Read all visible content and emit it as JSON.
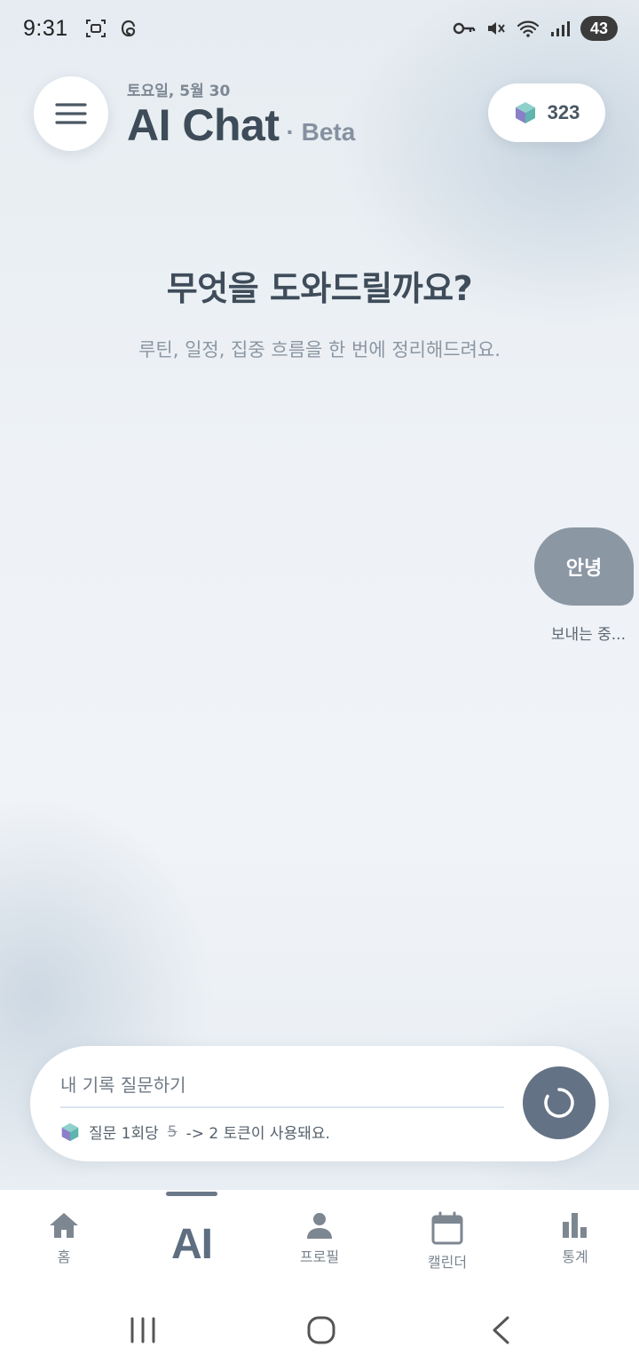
{
  "status_bar": {
    "time": "9:31",
    "battery": "43",
    "icons_left": [
      "screenshot-icon",
      "threads-icon"
    ],
    "icons_right": [
      "vpn-key-icon",
      "mute-icon",
      "wifi-icon",
      "signal-icon"
    ]
  },
  "header": {
    "date": "토요일, 5월 30",
    "title": "AI Chat",
    "badge": "· Beta",
    "token_count": "323"
  },
  "hero": {
    "title": "무엇을 도와드릴까요?",
    "subtitle": "루틴, 일정, 집중 흐름을 한 번에 정리해드려요."
  },
  "messages": [
    {
      "role": "user",
      "text": "안녕",
      "status": "보내는 중..."
    }
  ],
  "composer": {
    "placeholder": "내 기록 질문하기",
    "hint_prefix": "질문 1회당",
    "hint_old_cost": "5",
    "hint_suffix": "-> 2 토큰이 사용돼요."
  },
  "bottom_nav": {
    "active": "AI",
    "items": [
      {
        "id": "home",
        "label": "홈"
      },
      {
        "id": "ai",
        "label": "AI"
      },
      {
        "id": "profile",
        "label": "프로필"
      },
      {
        "id": "calendar",
        "label": "캘린더"
      },
      {
        "id": "stats",
        "label": "통계"
      }
    ]
  },
  "colors": {
    "accent": "#637284",
    "bubble": "#8c97a4",
    "title": "#3e4b58"
  }
}
